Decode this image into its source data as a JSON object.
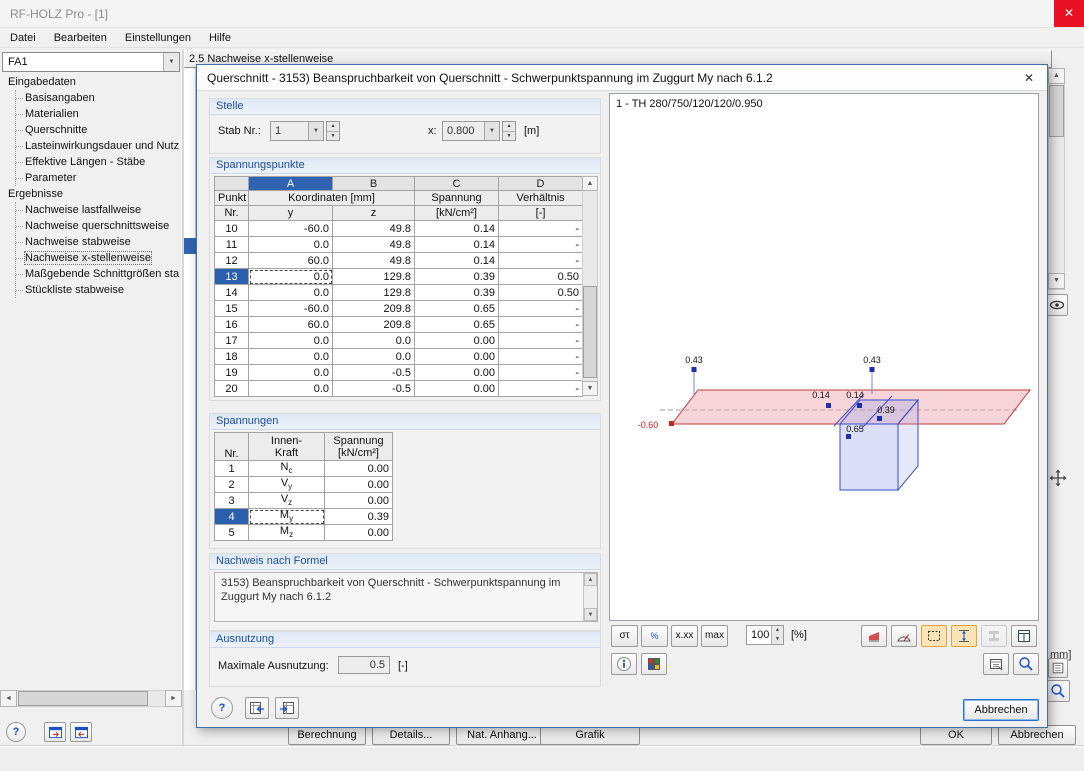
{
  "icons": {
    "close_x": "✕",
    "dropdown": "▼",
    "spin_up": "▲",
    "spin_down": "▼",
    "scroll_up": "▲",
    "scroll_down": "▼",
    "scroll_left": "◄",
    "scroll_right": "►",
    "help": "?"
  },
  "window": {
    "title": "RF-HOLZ Pro - [1]"
  },
  "menu": {
    "items": [
      {
        "label": "Datei"
      },
      {
        "label": "Bearbeiten"
      },
      {
        "label": "Einstellungen"
      },
      {
        "label": "Hilfe"
      }
    ]
  },
  "left_panel": {
    "case_selector": "FA1",
    "tree": [
      {
        "label": "Eingabedaten",
        "children": [
          {
            "label": "Basisangaben"
          },
          {
            "label": "Materialien"
          },
          {
            "label": "Querschnitte"
          },
          {
            "label": "Lasteinwirkungsdauer und Nutz"
          },
          {
            "label": "Effektive Längen - Stäbe"
          },
          {
            "label": "Parameter"
          }
        ]
      },
      {
        "label": "Ergebnisse",
        "children": [
          {
            "label": "Nachweise lastfallweise"
          },
          {
            "label": "Nachweise querschnittsweise"
          },
          {
            "label": "Nachweise stabweise"
          },
          {
            "label": "Nachweise x-stellenweise",
            "selected": true
          },
          {
            "label": "Maßgebende Schnittgrößen sta"
          },
          {
            "label": "Stückliste stabweise"
          }
        ]
      }
    ]
  },
  "background": {
    "section_title": "2.5 Nachweise x-stellenweise",
    "clipped_text": "mm]",
    "buttons": [
      {
        "label": "Berechnung",
        "disabled": true
      },
      {
        "label": "Details..."
      },
      {
        "label": "Nat. Anhang..."
      },
      {
        "label": "Grafik"
      },
      {
        "label": "OK"
      },
      {
        "label": "Abbrechen"
      }
    ]
  },
  "dialog": {
    "title": "Querschnitt - 3153) Beanspruchbarkeit von Querschnitt - Schwerpunktspannung im Zuggurt My nach 6.1.2",
    "stelle": {
      "caption": "Stelle",
      "stab_label": "Stab Nr.:",
      "stab_value": "1",
      "x_label": "x:",
      "x_value": "0.800",
      "x_unit": "[m]"
    },
    "spannungspunkte": {
      "caption": "Spannungspunkte",
      "letters": [
        "A",
        "B",
        "C",
        "D"
      ],
      "headers": {
        "punkt": "Punkt",
        "nr": "Nr.",
        "koordinaten": "Koordinaten [mm]",
        "y": "y",
        "z": "z",
        "spannung": "Spannung",
        "spannung_unit": "[kN/cm²]",
        "verhaeltnis": "Verhältnis",
        "verhaeltnis_unit": "[-]"
      },
      "rows": [
        {
          "nr": "10",
          "y": "-60.0",
          "z": "49.8",
          "s": "0.14",
          "v": "-"
        },
        {
          "nr": "11",
          "y": "0.0",
          "z": "49.8",
          "s": "0.14",
          "v": "-"
        },
        {
          "nr": "12",
          "y": "60.0",
          "z": "49.8",
          "s": "0.14",
          "v": "-"
        },
        {
          "nr": "13",
          "y": "0.0",
          "z": "129.8",
          "s": "0.39",
          "v": "0.50",
          "selected": true
        },
        {
          "nr": "14",
          "y": "0.0",
          "z": "129.8",
          "s": "0.39",
          "v": "0.50"
        },
        {
          "nr": "15",
          "y": "-60.0",
          "z": "209.8",
          "s": "0.65",
          "v": "-"
        },
        {
          "nr": "16",
          "y": "60.0",
          "z": "209.8",
          "s": "0.65",
          "v": "-"
        },
        {
          "nr": "17",
          "y": "0.0",
          "z": "0.0",
          "s": "0.00",
          "v": "-"
        },
        {
          "nr": "18",
          "y": "0.0",
          "z": "0.0",
          "s": "0.00",
          "v": "-"
        },
        {
          "nr": "19",
          "y": "0.0",
          "z": "-0.5",
          "s": "0.00",
          "v": "-"
        },
        {
          "nr": "20",
          "y": "0.0",
          "z": "-0.5",
          "s": "0.00",
          "v": "-"
        }
      ]
    },
    "spannungen": {
      "caption": "Spannungen",
      "headers": {
        "nr": "Nr.",
        "kraft_line1": "Innen-",
        "kraft_line2": "Kraft",
        "spannung_line1": "Spannung",
        "spannung_line2": "[kN/cm²]"
      },
      "rows": [
        {
          "nr": "1",
          "sym": "N",
          "sub": "c",
          "s": "0.00"
        },
        {
          "nr": "2",
          "sym": "V",
          "sub": "y",
          "s": "0.00"
        },
        {
          "nr": "3",
          "sym": "V",
          "sub": "z",
          "s": "0.00"
        },
        {
          "nr": "4",
          "sym": "M",
          "sub": "y",
          "s": "0.39",
          "selected": true
        },
        {
          "nr": "5",
          "sym": "M",
          "sub": "z",
          "s": "0.00"
        }
      ]
    },
    "formel": {
      "caption": "Nachweis nach Formel",
      "text": "3153) Beanspruchbarkeit von Querschnitt - Schwerpunktspannung im Zuggurt My nach 6.1.2"
    },
    "ausnutzung": {
      "caption": "Ausnutzung",
      "label": "Maximale Ausnutzung:",
      "value": "0.5",
      "unit": "[-]"
    },
    "graphic": {
      "title": "1 - TH 280/750/120/120/0.950",
      "labels": {
        "flange_min": "-0.60",
        "top_left": "0.43",
        "top_right": "0.43",
        "web_left": "0.14",
        "web_right": "0.14",
        "web_mid": "0.39",
        "web_lower": "0.65"
      }
    },
    "toolbar": {
      "buttons": [
        {
          "label": "στ"
        },
        {
          "label": "%"
        },
        {
          "label": "x.xx"
        },
        {
          "label": "max"
        }
      ],
      "zoom_value": "100",
      "zoom_unit": "[%]"
    },
    "cancel_label": "Abbrechen"
  }
}
